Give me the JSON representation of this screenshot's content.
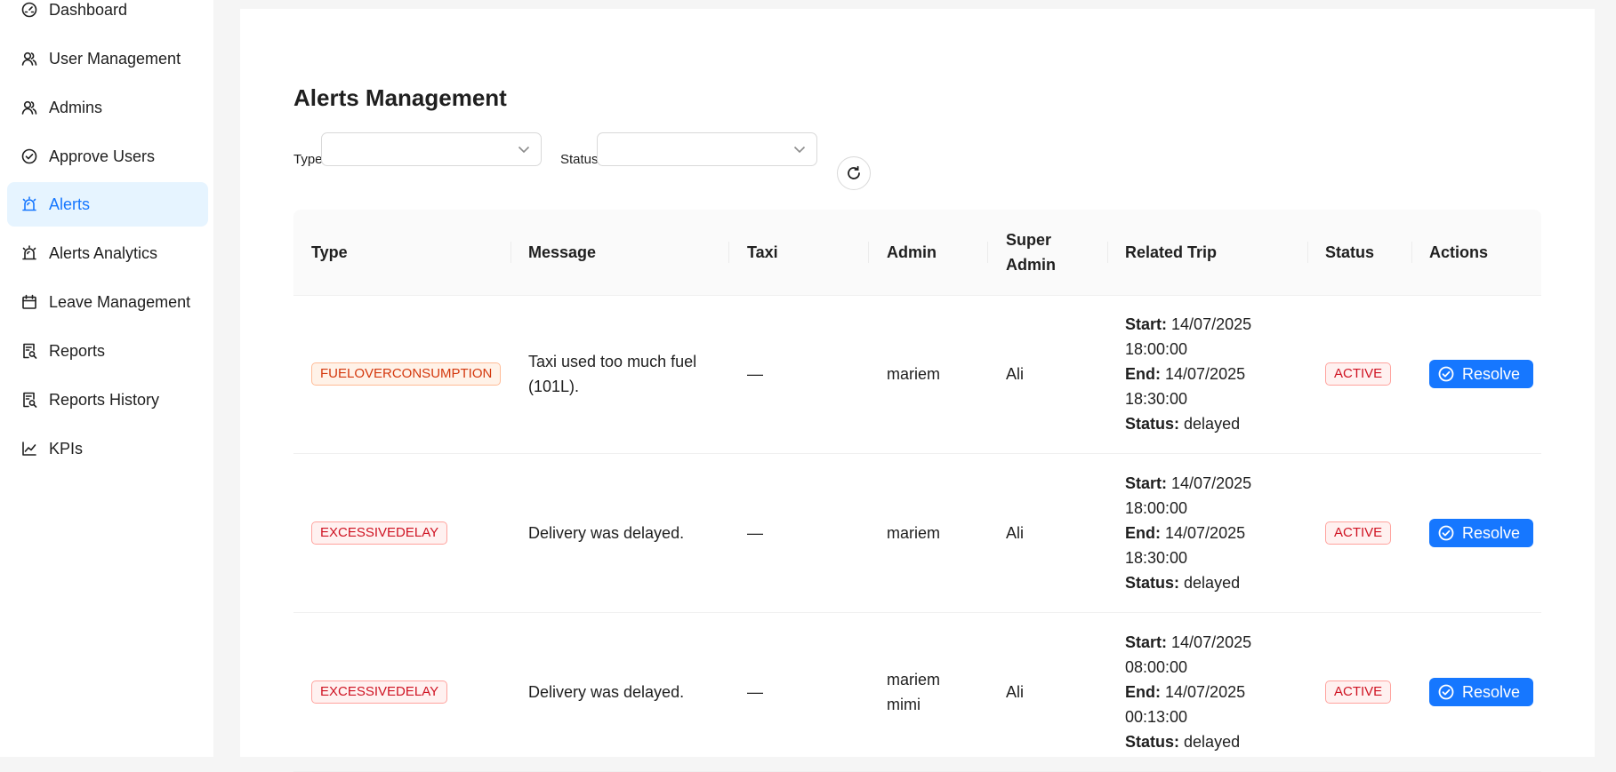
{
  "sidebar": {
    "items": [
      {
        "label": "Dashboard",
        "icon": "dashboard-icon",
        "active": false
      },
      {
        "label": "User Management",
        "icon": "users-icon",
        "active": false
      },
      {
        "label": "Admins",
        "icon": "users-icon",
        "active": false
      },
      {
        "label": "Approve Users",
        "icon": "check-circle-icon",
        "active": false
      },
      {
        "label": "Alerts",
        "icon": "alert-icon",
        "active": true
      },
      {
        "label": "Alerts Analytics",
        "icon": "alert-icon",
        "active": false
      },
      {
        "label": "Leave Management",
        "icon": "calendar-icon",
        "active": false
      },
      {
        "label": "Reports",
        "icon": "file-search-icon",
        "active": false
      },
      {
        "label": "Reports History",
        "icon": "file-search-icon",
        "active": false
      },
      {
        "label": "KPIs",
        "icon": "line-chart-icon",
        "active": false
      }
    ]
  },
  "main": {
    "title": "Alerts Management",
    "filters": {
      "type_label": "Type",
      "type_value": "",
      "status_label": "Status",
      "status_value": ""
    },
    "table": {
      "columns": [
        "Type",
        "Message",
        "Taxi",
        "Admin",
        "Super Admin",
        "Related Trip",
        "Status",
        "Actions"
      ],
      "trip_labels": {
        "start": "Start:",
        "end": "End:",
        "status": "Status:"
      },
      "rows": [
        {
          "type": "FUELOVERCONSUMPTION",
          "type_color": "orange",
          "message": "Taxi used too much fuel (101L).",
          "taxi": "—",
          "admin": "mariem",
          "super_admin": "Ali",
          "trip": {
            "start": "14/07/2025 18:00:00",
            "end": "14/07/2025 18:30:00",
            "status": "delayed"
          },
          "status": "ACTIVE",
          "action": "Resolve"
        },
        {
          "type": "EXCESSIVEDELAY",
          "type_color": "red",
          "message": "Delivery was delayed.",
          "taxi": "—",
          "admin": "mariem",
          "super_admin": "Ali",
          "trip": {
            "start": "14/07/2025 18:00:00",
            "end": "14/07/2025 18:30:00",
            "status": "delayed"
          },
          "status": "ACTIVE",
          "action": "Resolve"
        },
        {
          "type": "EXCESSIVEDELAY",
          "type_color": "red",
          "message": "Delivery was delayed.",
          "taxi": "—",
          "admin": "mariem mimi",
          "super_admin": "Ali",
          "trip": {
            "start": "14/07/2025 08:00:00",
            "end": "14/07/2025 00:13:00",
            "status": "delayed"
          },
          "status": "ACTIVE",
          "action": "Resolve"
        }
      ]
    }
  },
  "colors": {
    "accent": "#1677ff",
    "active_bg": "#e6f4ff",
    "tag_red": "#cf1322",
    "tag_orange": "#d4380d"
  }
}
